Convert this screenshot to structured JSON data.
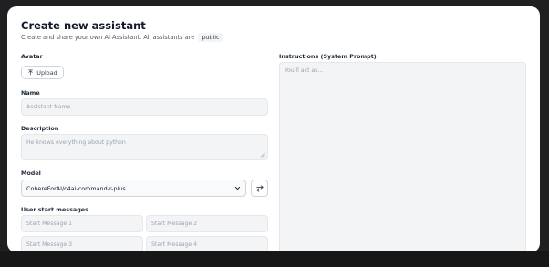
{
  "dialog": {
    "title": "Create new assistant",
    "subtitle": "Create and share your own AI Assistant. All assistants are",
    "visibility_badge": "public"
  },
  "avatar": {
    "label": "Avatar",
    "upload_label": "Upload",
    "icon": "upload-icon"
  },
  "name": {
    "label": "Name",
    "placeholder": "Assistant Name",
    "value": ""
  },
  "description": {
    "label": "Description",
    "placeholder": "He knows everything about python",
    "value": ""
  },
  "model": {
    "label": "Model",
    "selected": "CohereForAI/c4ai-command-r-plus",
    "settings_icon": "sliders-icon"
  },
  "start_messages": {
    "label": "User start messages",
    "placeholders": [
      "Start Message 1",
      "Start Message 2",
      "Start Message 3",
      "Start Message 4"
    ]
  },
  "instructions": {
    "label": "Instructions (System Prompt)",
    "placeholder": "You'll act as..."
  },
  "colors": {
    "backdrop": "#202022",
    "panel": "#ffffff",
    "input_bg": "#f3f4f6",
    "border": "#e5e7eb"
  }
}
